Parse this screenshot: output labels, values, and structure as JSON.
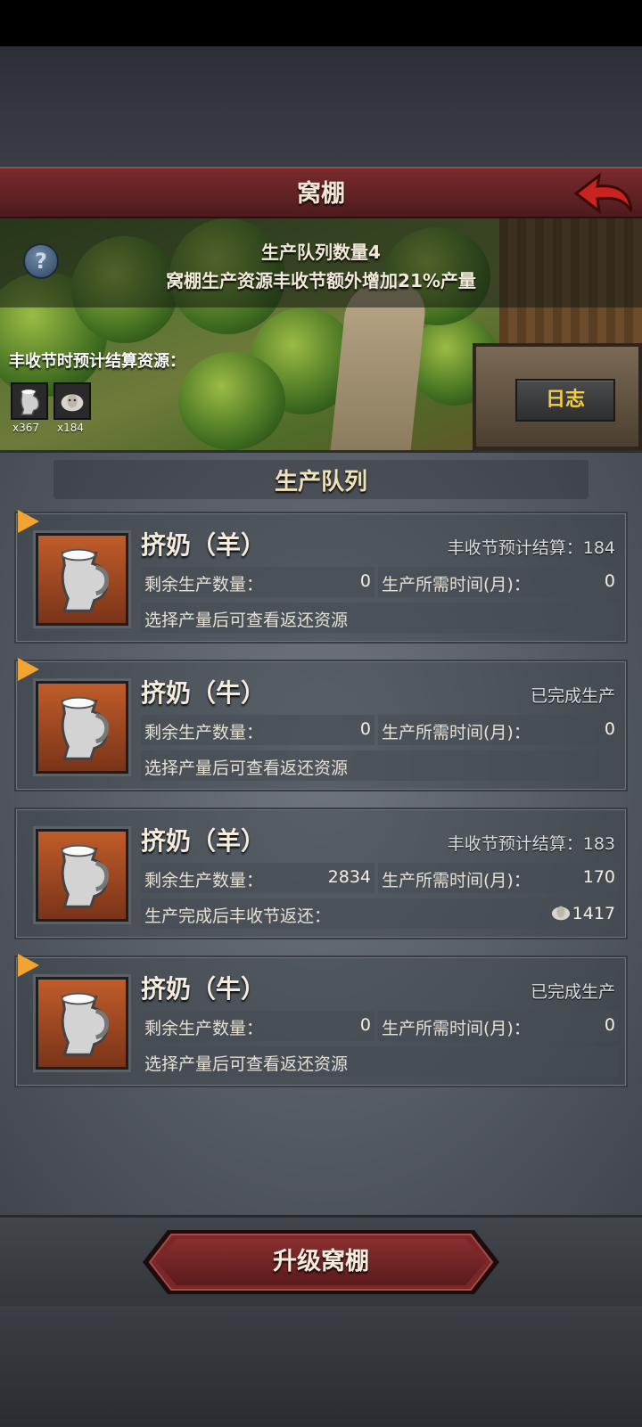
{
  "header": {
    "title": "窝棚"
  },
  "banner": {
    "queue_count": "生产队列数量4",
    "bonus_text": "窝棚生产资源丰收节额外增加21%产量",
    "forecast_label": "丰收节时预计结算资源：",
    "resources": [
      {
        "icon": "milk-jug-icon",
        "count": "x367"
      },
      {
        "icon": "sheep-icon",
        "count": "x184"
      }
    ],
    "log_button": "日志"
  },
  "panel": {
    "title": "生产队列",
    "queue": [
      {
        "name": "挤奶（羊）",
        "status": "丰收节预计结算：184",
        "remaining_label": "剩余生产数量：",
        "remaining": "0",
        "time_label": "生产所需时间(月)：",
        "time": "0",
        "footer": "选择产量后可查看返还资源",
        "footer_value": ""
      },
      {
        "name": "挤奶（牛）",
        "status": "已完成生产",
        "remaining_label": "剩余生产数量：",
        "remaining": "0",
        "time_label": "生产所需时间(月)：",
        "time": "0",
        "footer": "选择产量后可查看返还资源",
        "footer_value": ""
      },
      {
        "name": "挤奶（羊）",
        "status": "丰收节预计结算：183",
        "remaining_label": "剩余生产数量：",
        "remaining": "2834",
        "time_label": "生产所需时间(月)：",
        "time": "170",
        "footer": "生产完成后丰收节返还：",
        "footer_value": "1417"
      },
      {
        "name": "挤奶（牛）",
        "status": "已完成生产",
        "remaining_label": "剩余生产数量：",
        "remaining": "0",
        "time_label": "生产所需时间(月)：",
        "time": "0",
        "footer": "选择产量后可查看返还资源",
        "footer_value": ""
      }
    ]
  },
  "upgrade_button": "升级窝棚"
}
